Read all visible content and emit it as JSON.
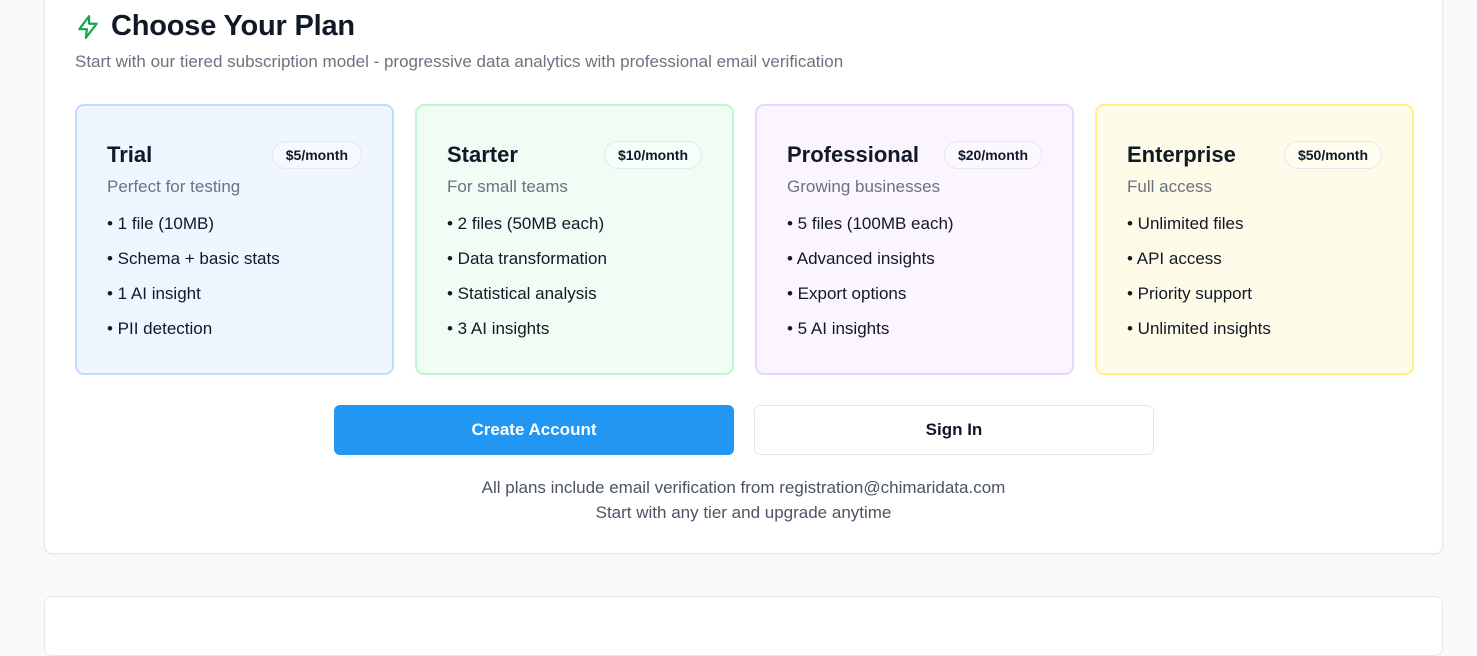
{
  "header": {
    "title": "Choose Your Plan",
    "subtitle": "Start with our tiered subscription model - progressive data analytics with professional email verification",
    "icon": "lightning-icon",
    "accent": "#16a34a"
  },
  "plans": [
    {
      "name": "Trial",
      "price": "$5/month",
      "description": "Perfect for testing",
      "features": [
        "• 1 file (10MB)",
        "• Schema + basic stats",
        "• 1 AI insight",
        "• PII detection"
      ],
      "background": "#eff6ff",
      "border": "#bfdbfe"
    },
    {
      "name": "Starter",
      "price": "$10/month",
      "description": "For small teams",
      "features": [
        "• 2 files (50MB each)",
        "• Data transformation",
        "• Statistical analysis",
        "• 3 AI insights"
      ],
      "background": "#f0fdf4",
      "border": "#bbf7d0"
    },
    {
      "name": "Professional",
      "price": "$20/month",
      "description": "Growing businesses",
      "features": [
        "• 5 files (100MB each)",
        "• Advanced insights",
        "• Export options",
        "• 5 AI insights"
      ],
      "background": "#faf5ff",
      "border": "#e9d5ff"
    },
    {
      "name": "Enterprise",
      "price": "$50/month",
      "description": "Full access",
      "features": [
        "• Unlimited files",
        "• API access",
        "• Priority support",
        "• Unlimited insights"
      ],
      "background": "#fefce8",
      "border": "#fef08a"
    }
  ],
  "actions": {
    "create_account_label": "Create Account",
    "sign_in_label": "Sign In",
    "primary_color": "#2196f3"
  },
  "footer": {
    "note_line1": "All plans include email verification from registration@chimaridata.com",
    "note_line2": "Start with any tier and upgrade anytime"
  }
}
